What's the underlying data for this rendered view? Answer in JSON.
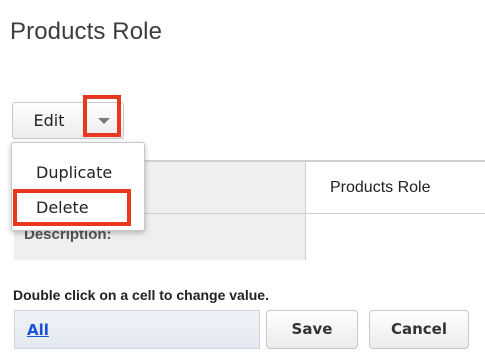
{
  "page": {
    "title": "Products Role"
  },
  "toolbar": {
    "edit_label": "Edit",
    "dropdown_icon": "caret-down-icon"
  },
  "dropdown_menu": {
    "items": [
      {
        "label": "Duplicate"
      },
      {
        "label": "Delete"
      }
    ]
  },
  "detail_table": {
    "rows": [
      {
        "label": "",
        "value": "Products Role"
      },
      {
        "label": "Description:",
        "value": ""
      }
    ]
  },
  "hint": "Double click on a cell to change value.",
  "bottom_bar": {
    "all_link": "All",
    "save_label": "Save",
    "cancel_label": "Cancel"
  },
  "colors": {
    "highlight": "#e8391f",
    "link": "#1a53d8"
  }
}
